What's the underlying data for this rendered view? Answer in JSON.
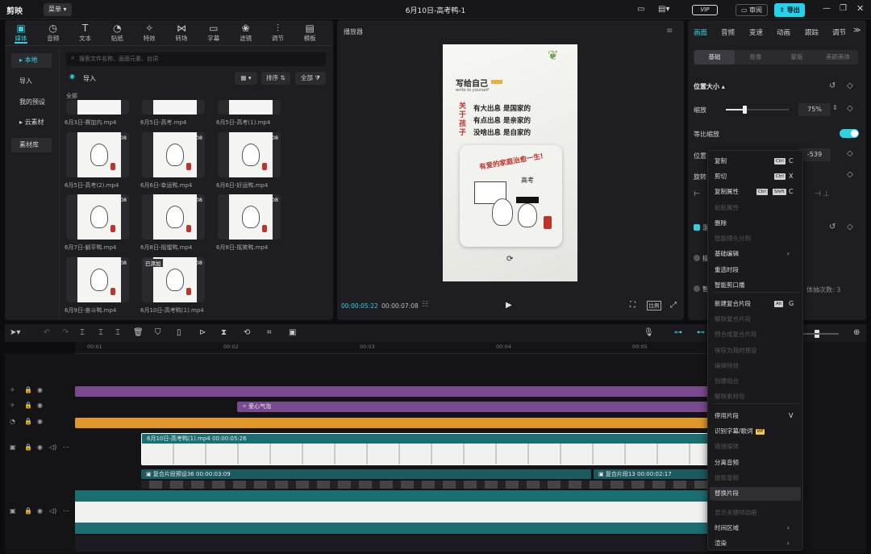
{
  "app": {
    "name": "剪映",
    "menu_label": "菜单",
    "project_title": "6月10日-高考鸭-1",
    "vip_label": "VIP",
    "review_label": "审阅",
    "export_label": "导出"
  },
  "media_tabs": [
    {
      "label": "媒体",
      "icon": "media-icon"
    },
    {
      "label": "音频",
      "icon": "audio-icon"
    },
    {
      "label": "文本",
      "icon": "text-icon"
    },
    {
      "label": "贴纸",
      "icon": "sticker-icon"
    },
    {
      "label": "特效",
      "icon": "effects-icon"
    },
    {
      "label": "转场",
      "icon": "transition-icon"
    },
    {
      "label": "字幕",
      "icon": "subtitle-icon"
    },
    {
      "label": "滤镜",
      "icon": "filter-icon"
    },
    {
      "label": "调节",
      "icon": "adjust-icon"
    },
    {
      "label": "模板",
      "icon": "template-icon"
    }
  ],
  "sidebar": {
    "local": "本地",
    "import": "导入",
    "my_presets": "我的预设",
    "cloud": "云素材",
    "library": "素材库"
  },
  "media": {
    "search_placeholder": "搜索文件名称、画面元素、台词",
    "import_label": "导入",
    "sort_label": "排序",
    "filter_label": "全部",
    "all_label": "全部",
    "files": [
      {
        "name": "6月3日-赛加内.mp4",
        "duration": ""
      },
      {
        "name": "6月5日-高考.mp4",
        "duration": ""
      },
      {
        "name": "6月5日-高考(1).mp4",
        "duration": ""
      },
      {
        "name": "6月5日-高考(2).mp4",
        "duration": "08"
      },
      {
        "name": "6月6日-幸运鸭.mp4",
        "duration": "08"
      },
      {
        "name": "6月6日-好运鸭.mp4",
        "duration": "08"
      },
      {
        "name": "6月7日-躺平鸭.mp4",
        "duration": "08"
      },
      {
        "name": "6月8日-摇惺鸭.mp4",
        "duration": "08"
      },
      {
        "name": "6月8日-摇笑鸭.mp4",
        "duration": "08"
      },
      {
        "name": "6月9日-奋斗鸭.mp4",
        "duration": "08"
      },
      {
        "name": "6月10日-高考鸭(1).mp4",
        "duration": "08",
        "badge": "已添加"
      }
    ]
  },
  "player": {
    "title": "播放器",
    "current_time": "00:00:05:22",
    "total_time": "00:00:07:08",
    "ratio_label": "比例",
    "poster": {
      "heading": "写给自己",
      "subheading": "write to yourself",
      "side_text": "关于孩子",
      "lines": [
        "有大出息 是国家的",
        "有点出息 是亲家的",
        "没啥出息 是自家的"
      ],
      "card_title": "有爱的家庭治愈一生!",
      "banner": "高考"
    }
  },
  "inspector": {
    "tabs": [
      "画面",
      "音频",
      "变速",
      "动画",
      "跟踪",
      "调节"
    ],
    "subtabs": [
      "基础",
      "抠像",
      "蒙版",
      "美颜美体"
    ],
    "section_title": "位置大小",
    "scale_label": "缩放",
    "scale_value": "75%",
    "scale_fraction": 0.3,
    "uniform_scale_label": "等比缩放",
    "position_label": "位置",
    "position_y": "-539",
    "rotate_label": "旋转",
    "mix_label": "混",
    "stroke_label": "描",
    "loop_label": "智",
    "loop_count_text": "体抽次数: 3"
  },
  "timeline": {
    "ruler_ticks": [
      "00:01",
      "00:02",
      "00:03",
      "00:04",
      "00:05"
    ],
    "effect_clip": "爱心气泡",
    "main_clip": {
      "name": "6月10日-高考鸭(1).mp4",
      "duration": "00:00:05:26"
    },
    "compound_clips": [
      {
        "name": "复合片段预设36",
        "duration": "00:00:03:09"
      },
      {
        "name": "复合片段13",
        "duration": "00:00:02:17"
      }
    ]
  },
  "context_menu": [
    {
      "label": "复制",
      "kbd": [
        "Ctrl"
      ],
      "key": "C",
      "disabled": false
    },
    {
      "label": "剪切",
      "kbd": [
        "Ctrl"
      ],
      "key": "X",
      "disabled": false
    },
    {
      "label": "复制属性",
      "kbd": [
        "Ctrl",
        "Shift"
      ],
      "key": "C",
      "disabled": false
    },
    {
      "label": "粘贴属性",
      "disabled": true
    },
    {
      "label": "删除",
      "disabled": false
    },
    {
      "label": "智能镜头分割",
      "disabled": true
    },
    {
      "label": "基础编辑",
      "disabled": false,
      "submenu": true
    },
    {
      "label": "重选时段",
      "disabled": false
    },
    {
      "label": "智能剪口播",
      "disabled": false
    },
    {
      "label": "新建复合片段",
      "kbd": [
        "Alt"
      ],
      "key": "G",
      "disabled": false
    },
    {
      "label": "解除复合片段",
      "disabled": true
    },
    {
      "label": "预合成复合片段",
      "disabled": true
    },
    {
      "label": "保存为我的预设",
      "disabled": true
    },
    {
      "label": "编辑特效",
      "disabled": true
    },
    {
      "label": "创建组合",
      "disabled": true
    },
    {
      "label": "解除素材包",
      "disabled": true
    },
    {
      "label": "停用片段",
      "key": "V",
      "disabled": false
    },
    {
      "label": "识别字幕/歌词",
      "disabled": false,
      "vip": "VIP"
    },
    {
      "label": "链接媒体",
      "disabled": true
    },
    {
      "label": "分离音频",
      "disabled": false
    },
    {
      "label": "提取音频",
      "disabled": true
    },
    {
      "label": "替换片段",
      "disabled": false,
      "hover": true
    },
    {
      "label": "显示关键帧动画",
      "disabled": true
    },
    {
      "label": "时间区域",
      "disabled": false,
      "submenu": true
    },
    {
      "label": "渲染",
      "disabled": false,
      "submenu": true
    }
  ],
  "colors": {
    "accent": "#2fd3e0",
    "purple_track": "#7a4a8f",
    "orange_track": "#e0982a",
    "teal_clip": "#1b6e72",
    "export_btn": "#22d3ee"
  }
}
